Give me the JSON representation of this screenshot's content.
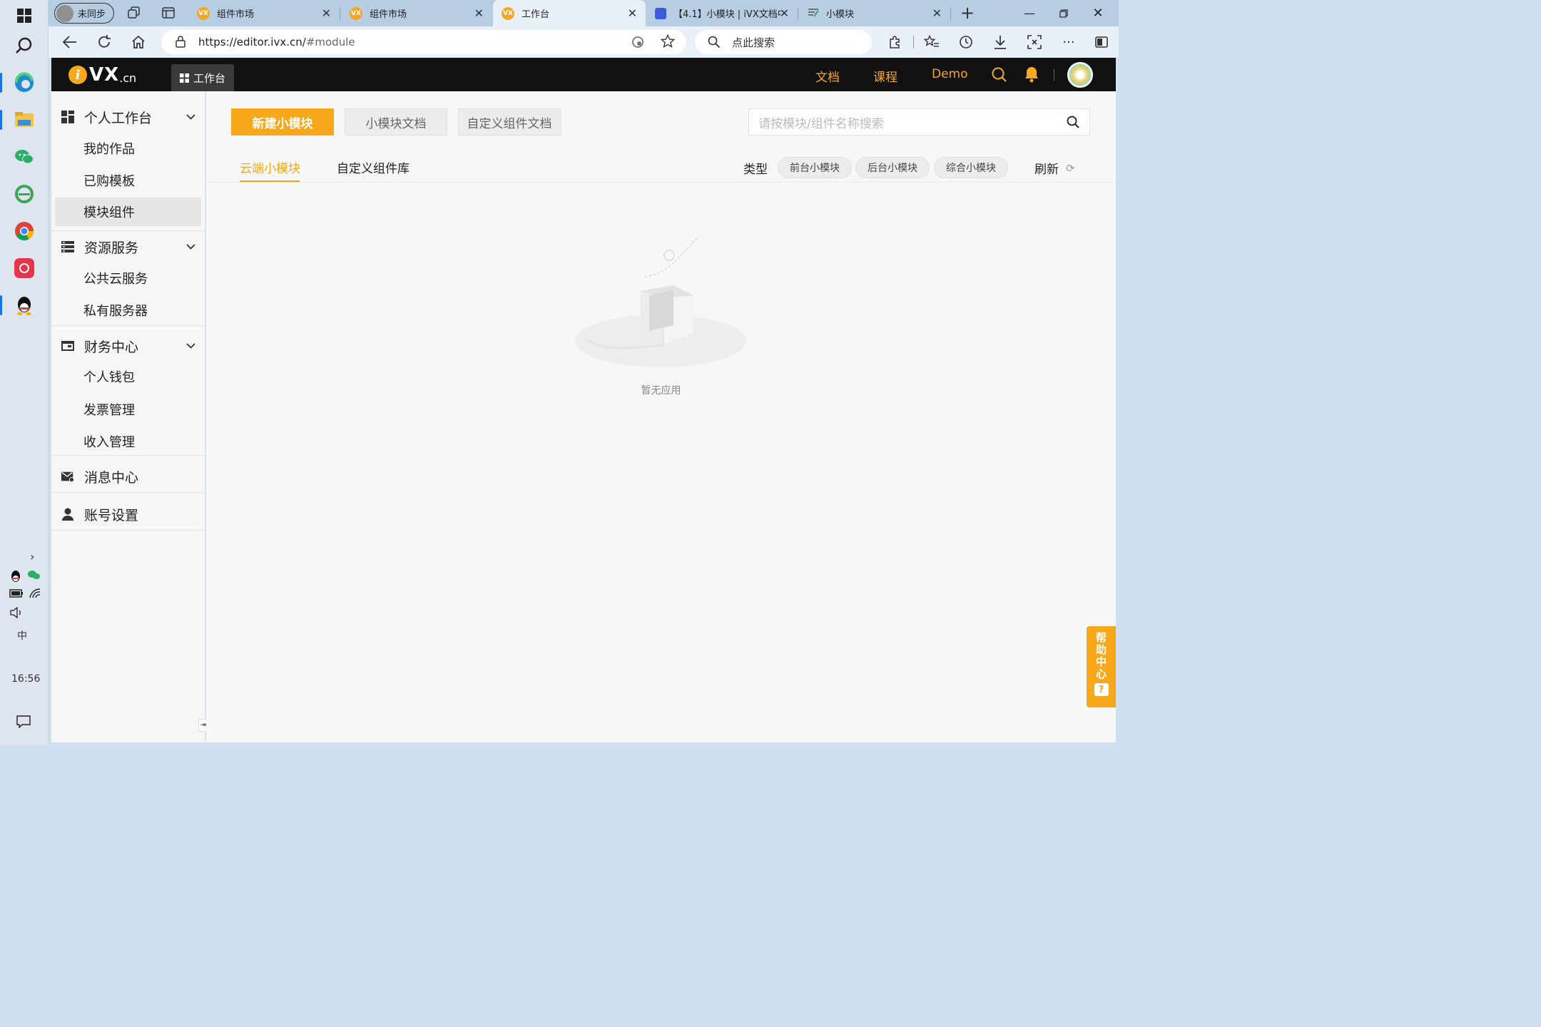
{
  "browser": {
    "profile_label": "未同步",
    "tabs": [
      {
        "title": "组件市场",
        "favicon": "VX"
      },
      {
        "title": "组件市场",
        "favicon": "VX"
      },
      {
        "title": "工作台",
        "favicon": "VX",
        "active": true
      },
      {
        "title": "【4.1】小模块 | iVX文档中",
        "favicon": "doc-icon"
      },
      {
        "title": "小模块",
        "favicon": "edit-icon"
      }
    ],
    "url_host": "https://editor.ivx.cn/",
    "url_path": "#module",
    "search_placeholder": "点此搜索"
  },
  "taskbar": {
    "clock": "16:56",
    "ime": "中",
    "accent": "#1a73e8"
  },
  "header": {
    "logo_vx": "VX",
    "logo_cn": ".cn",
    "workbench_label": "工作台",
    "links": [
      "文档",
      "课程",
      "Demo"
    ],
    "accent": "#f7a81b"
  },
  "sidebar": {
    "groups": [
      {
        "label": "个人工作台",
        "icon": "dashboard-icon",
        "items": [
          "我的作品",
          "已购模板",
          "模块组件"
        ]
      },
      {
        "label": "资源服务",
        "icon": "server-icon",
        "items": [
          "公共云服务",
          "私有服务器"
        ]
      },
      {
        "label": "财务中心",
        "icon": "wallet-icon",
        "items": [
          "个人钱包",
          "发票管理",
          "收入管理"
        ]
      },
      {
        "label": "消息中心",
        "icon": "mail-icon",
        "items": []
      },
      {
        "label": "账号设置",
        "icon": "user-icon",
        "items": []
      }
    ],
    "selected_item": "模块组件"
  },
  "main": {
    "btn_new": "新建小模块",
    "btn_doc": "小模块文档",
    "btn_custom_doc": "自定义组件文档",
    "search_placeholder": "请按模块/组件名称搜索",
    "subtabs": [
      "云端小模块",
      "自定义组件库"
    ],
    "type_label": "类型",
    "type_filters": [
      "前台小模块",
      "后台小模块",
      "综合小模块"
    ],
    "refresh_label": "刷新",
    "empty_text": "暂无应用"
  },
  "help": {
    "label_chars": [
      "帮",
      "助",
      "中",
      "心"
    ],
    "icon": "?"
  }
}
